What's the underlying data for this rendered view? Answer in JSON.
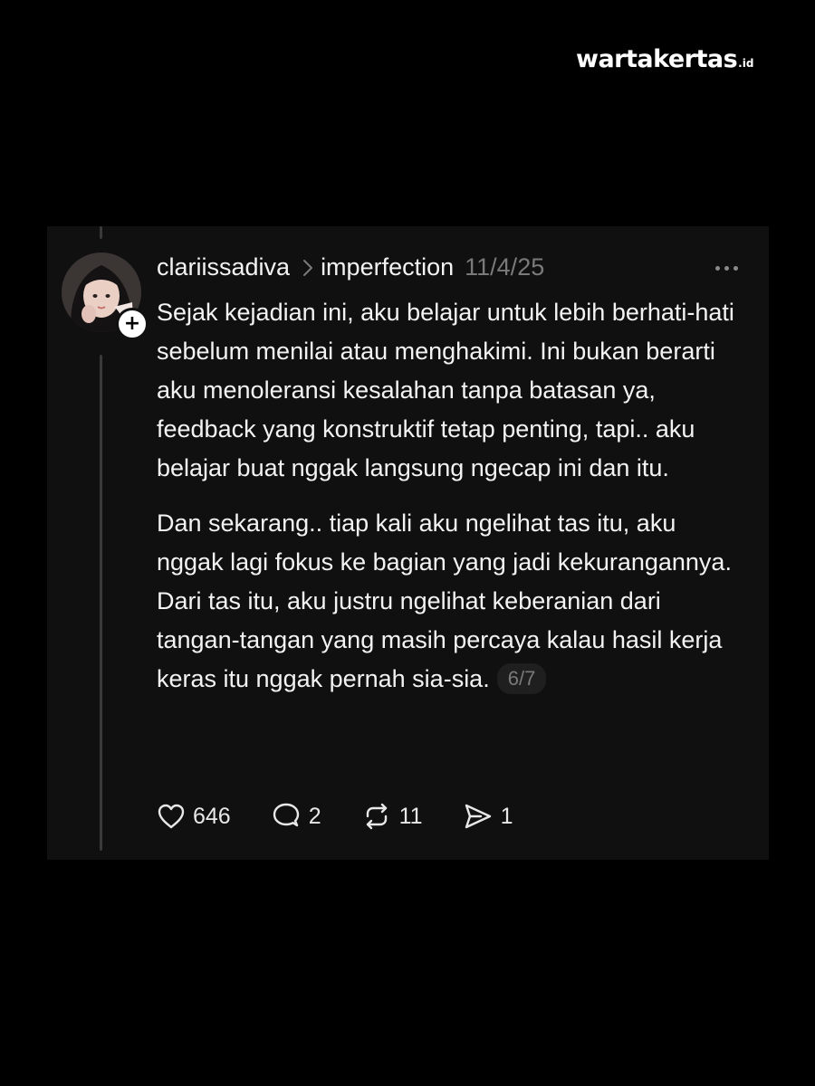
{
  "watermark": {
    "name": "wartakertas",
    "tld": ".id"
  },
  "post": {
    "username": "clariissadiva",
    "topic": "imperfection",
    "date": "11/4/25",
    "paragraphs": [
      "Sejak kejadian ini, aku belajar untuk lebih berhati-hati sebelum menilai atau menghakimi. Ini bukan berarti aku menoleransi kesalahan tanpa batasan ya, feedback yang konstruktif tetap penting, tapi.. aku belajar buat nggak langsung ngecap ini dan itu.",
      "Dan sekarang.. tiap kali aku ngelihat tas itu, aku nggak lagi fokus ke bagian yang jadi kekurangannya. Dari tas itu, aku justru ngelihat keberanian dari tangan-tangan yang masih percaya kalau hasil kerja keras itu nggak pernah sia-sia."
    ],
    "page_indicator": "6/7",
    "actions": {
      "likes": "646",
      "replies": "2",
      "reposts": "11",
      "shares": "1"
    }
  },
  "colors": {
    "background": "#000000",
    "card": "#101010",
    "text": "#f3f3f3",
    "muted": "#7a7a7a"
  }
}
